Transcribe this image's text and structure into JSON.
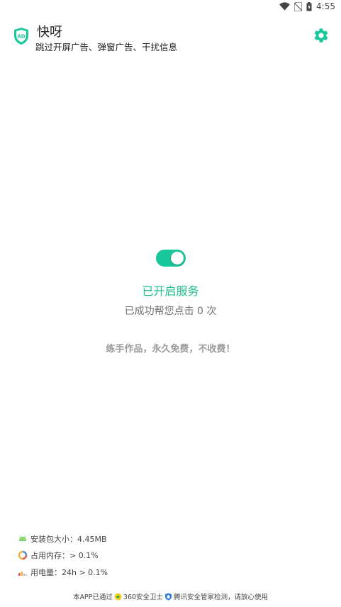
{
  "status_bar": {
    "time": "4:55",
    "icons": [
      "wifi-icon",
      "no-sim-icon",
      "battery-icon"
    ]
  },
  "header": {
    "title": "快呀",
    "subtitle": "跳过开屏广告、弹窗广告、干扰信息",
    "logo_text": "AD",
    "settings_icon": "gear-icon"
  },
  "service": {
    "enabled": true,
    "status_label": "已开启服务",
    "click_count_text": "已成功帮您点击 0 次",
    "free_note": "练手作品，永久免费，不收费！"
  },
  "stats": [
    {
      "icon": "android-icon",
      "label": "安装包大小：4.45MB"
    },
    {
      "icon": "memory-ring-icon",
      "label": "占用内存：> 0.1%"
    },
    {
      "icon": "battery-usage-icon",
      "label": "用电量：24h > 0.1%"
    }
  ],
  "footer": {
    "part1": "本APP已通过",
    "part2": "360安全卫士",
    "part3": "腾讯安全管家检测，请放心使用"
  },
  "colors": {
    "accent": "#19c79c",
    "status_text": "#1bbf8b"
  }
}
